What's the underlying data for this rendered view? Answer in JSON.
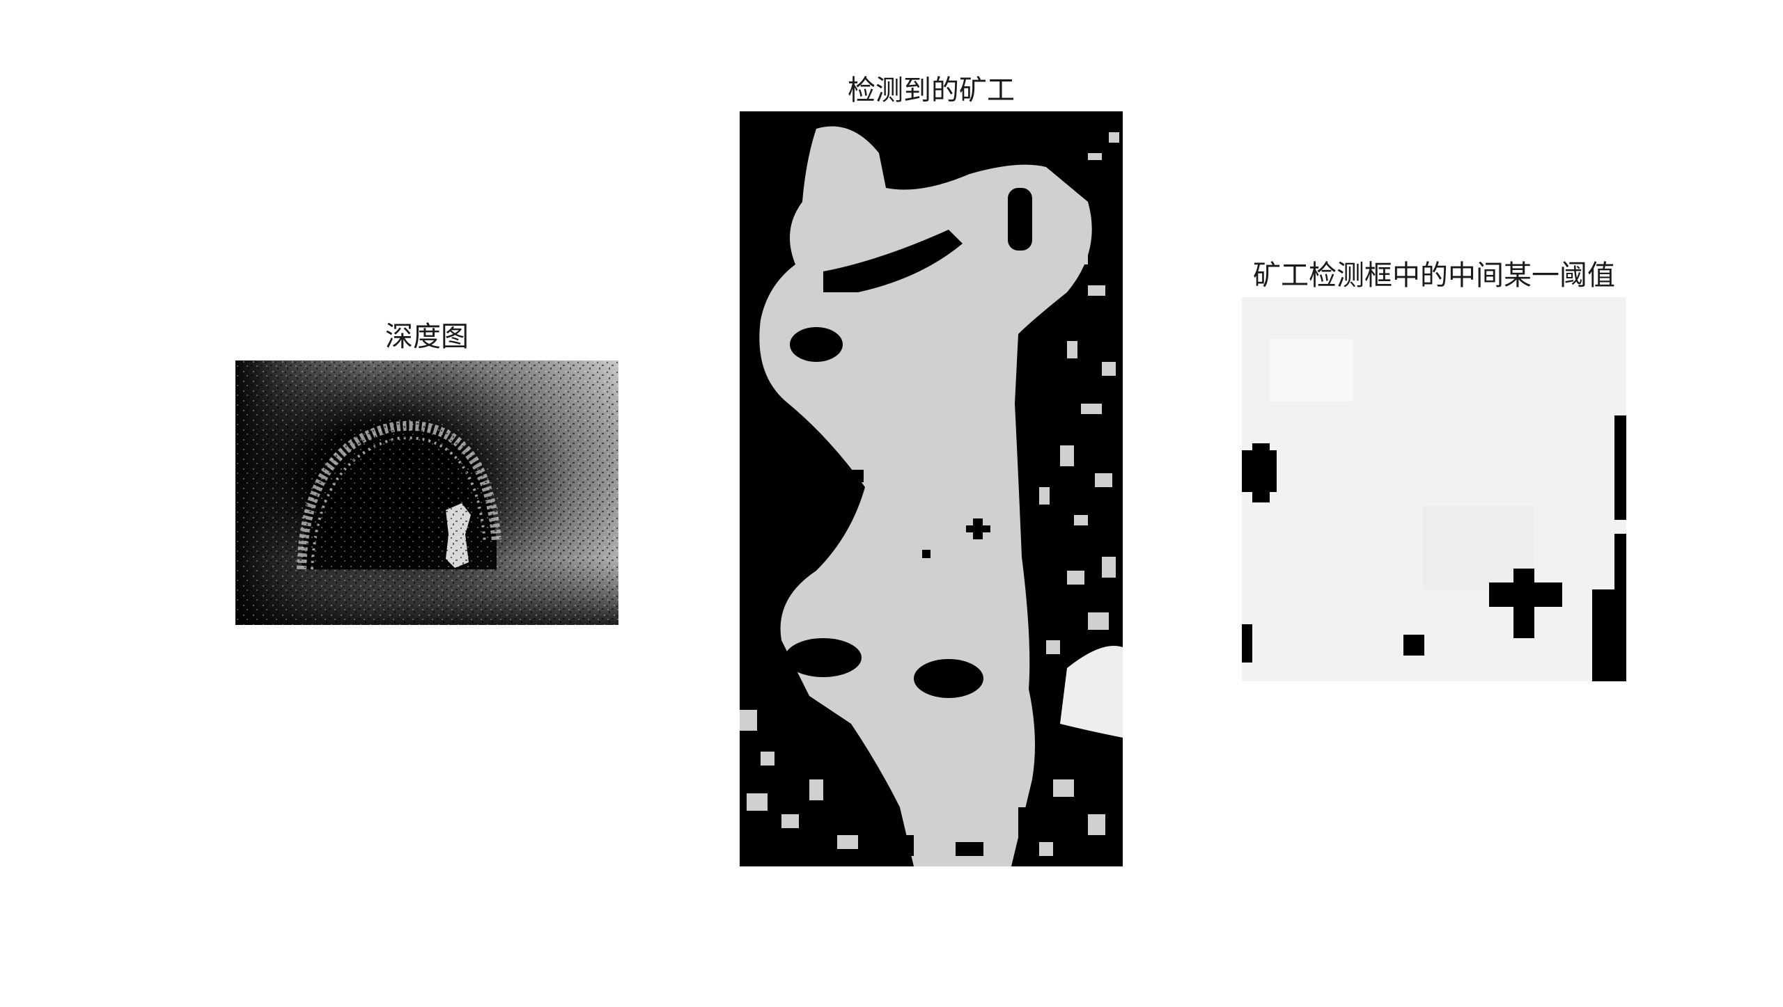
{
  "figure": {
    "panels": [
      {
        "id": "depth",
        "title": "深度图",
        "content": "grayscale depth image of a mine tunnel"
      },
      {
        "id": "detected",
        "title": "检测到的矿工",
        "content": "binary segmentation mask of the detected miner"
      },
      {
        "id": "threshold",
        "title": "矿工检测框中的中间某一阈值",
        "content": "thresholded region inside the miner detection box"
      }
    ]
  },
  "colors": {
    "background": "#ffffff",
    "foreground_gray": "#d0d0d0",
    "mask_black": "#000000",
    "threshold_light": "#f2f2f2"
  }
}
